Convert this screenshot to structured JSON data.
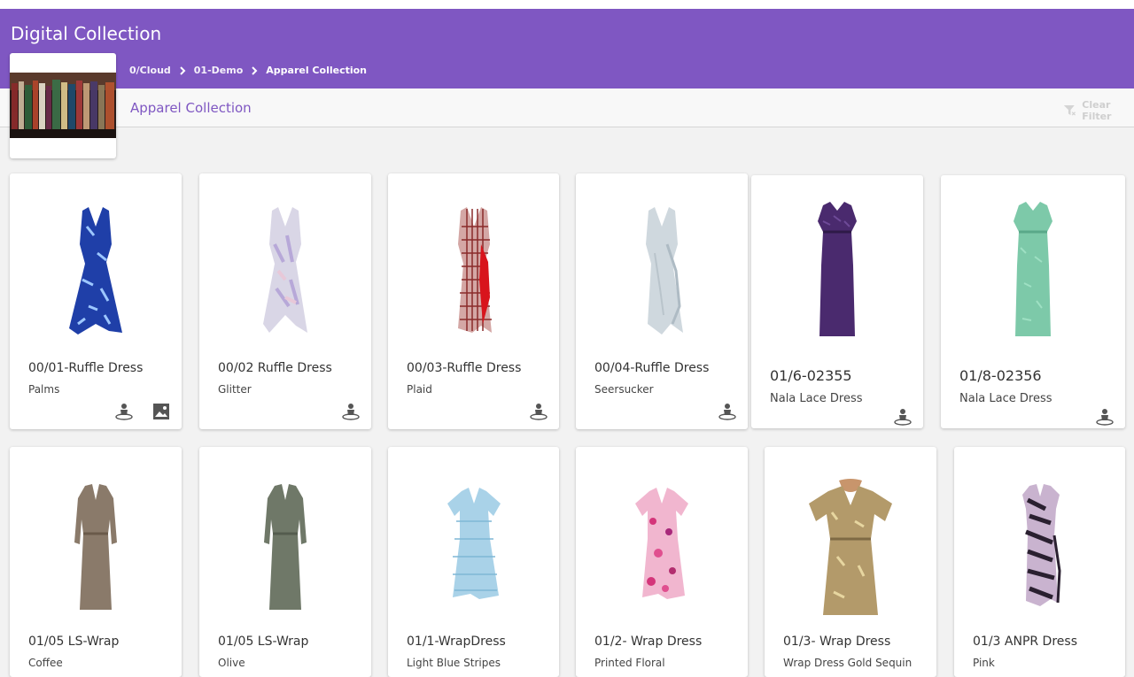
{
  "app": {
    "title": "Digital Collection"
  },
  "breadcrumb": [
    {
      "label": "0/Cloud"
    },
    {
      "label": "01-Demo"
    },
    {
      "label": "Apparel Collection"
    }
  ],
  "collection": {
    "title": "Apparel Collection"
  },
  "filter": {
    "clear_label": "Clear Filter",
    "icon": "filter-clear-icon"
  },
  "colors": {
    "header": "#7f57c2",
    "accent": "#7f57c2"
  },
  "row1": [
    {
      "name": "00/01-Ruffle Dress",
      "sub": "Palms",
      "icons": [
        "avatar-3d-icon",
        "image-icon"
      ]
    },
    {
      "name": "00/02 Ruffle Dress",
      "sub": "Glitter",
      "icons": [
        "avatar-3d-icon"
      ]
    },
    {
      "name": "00/03-Ruffle Dress",
      "sub": "Plaid",
      "icons": [
        "avatar-3d-icon"
      ]
    },
    {
      "name": "00/04-Ruffle Dress",
      "sub": "Seersucker",
      "icons": [
        "avatar-3d-icon"
      ]
    },
    {
      "name": "01/6-02355",
      "sub": "Nala Lace Dress",
      "icons": [
        "avatar-3d-icon"
      ]
    },
    {
      "name": "01/8-02356",
      "sub": "Nala Lace Dress",
      "icons": [
        "avatar-3d-icon"
      ]
    }
  ],
  "row2": [
    {
      "name": "01/05 LS-Wrap",
      "sub": "Coffee"
    },
    {
      "name": "01/05 LS-Wrap",
      "sub": "Olive"
    },
    {
      "name": "01/1-WrapDress",
      "sub": "Light Blue Stripes"
    },
    {
      "name": "01/2- Wrap Dress",
      "sub": "Printed Floral"
    },
    {
      "name": "01/3- Wrap Dress",
      "sub": "Wrap Dress Gold Sequin"
    },
    {
      "name": "01/3 ANPR Dress",
      "sub": "Pink"
    }
  ]
}
